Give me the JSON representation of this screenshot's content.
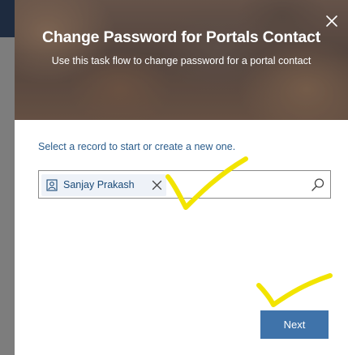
{
  "dialog": {
    "title": "Change Password for Portals Contact",
    "subtitle": "Use this task flow to change password for a portal contact",
    "instruction": "Select a record to start or create a new one.",
    "lookup": {
      "selected_record": "Sanjay Prakash",
      "record_icon": "contact-icon",
      "remove_icon": "close-icon",
      "search_icon": "search-icon"
    },
    "next_label": "Next"
  },
  "colors": {
    "accent_button": "#3f73aa",
    "link_text": "#2b5d8c",
    "annotation": "#f2e400"
  }
}
